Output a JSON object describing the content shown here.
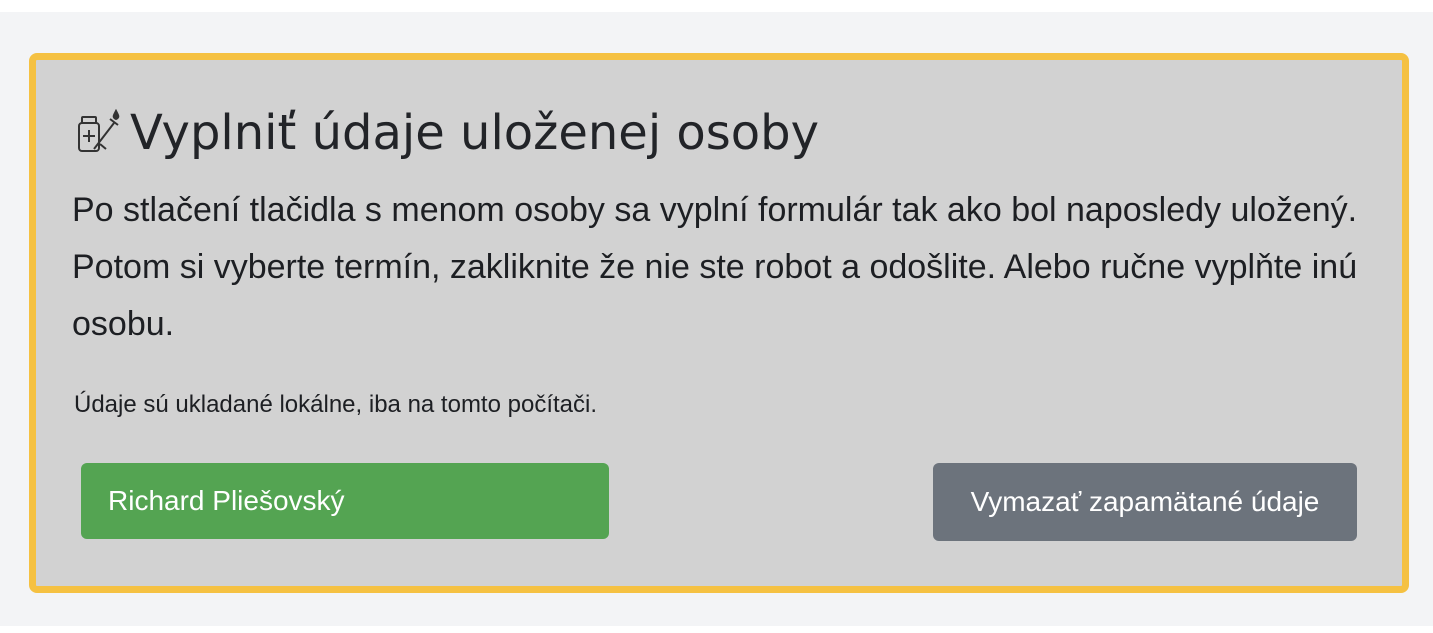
{
  "panel": {
    "title": "Vyplniť údaje uloženej osoby",
    "title_icon": "vaccine-syringe-icon",
    "description": "Po stlačení tlačidla s menom osoby sa vyplní formulár tak ako bol naposledy uložený. Potom si vyberte termín, zakliknite že nie ste robot a odošlite. Alebo ručne vyplňte inú osobu.",
    "storage_note": "Údaje sú ukladané lokálne, iba na tomto počítači.",
    "border_color": "#f5c142",
    "background_color": "#d2d2d2"
  },
  "saved_people": [
    {
      "name": "Richard Pliešovský",
      "color": "#54a452"
    }
  ],
  "actions": {
    "clear_label": "Vymazať zapamätané údaje",
    "clear_color": "#6c737c"
  }
}
